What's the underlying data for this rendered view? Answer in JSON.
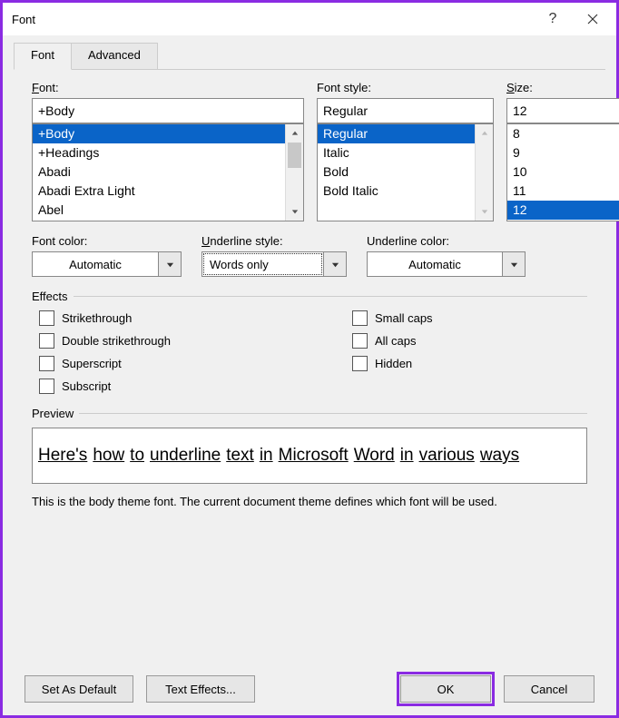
{
  "title": "Font",
  "tabs": {
    "font": "Font",
    "advanced": "Advanced"
  },
  "labels": {
    "font": "Font:",
    "style": "Font style:",
    "size": "Size:",
    "fontcolor": "Font color:",
    "underline": "Underline style:",
    "ulcolor": "Underline color:",
    "effects": "Effects",
    "preview": "Preview"
  },
  "font": {
    "value": "+Body",
    "items": [
      "+Body",
      "+Headings",
      "Abadi",
      "Abadi Extra Light",
      "Abel"
    ],
    "selected": 0
  },
  "style": {
    "value": "Regular",
    "items": [
      "Regular",
      "Italic",
      "Bold",
      "Bold Italic"
    ],
    "selected": 0
  },
  "size": {
    "value": "12",
    "items": [
      "8",
      "9",
      "10",
      "11",
      "12"
    ],
    "selected": 4
  },
  "fontcolor": "Automatic",
  "underline": "Words only",
  "ulcolor": "Automatic",
  "effects": {
    "strike": "Strikethrough",
    "dstrike": "Double strikethrough",
    "super": "Superscript",
    "sub": "Subscript",
    "smallcaps": "Small caps",
    "allcaps": "All caps",
    "hidden": "Hidden"
  },
  "preview_words": [
    "Here's",
    "how",
    "to",
    "underline",
    "text",
    "in",
    "Microsoft",
    "Word",
    "in",
    "various",
    "ways"
  ],
  "desc": "This is the body theme font. The current document theme defines which font will be used.",
  "buttons": {
    "default": "Set As Default",
    "texteffects": "Text Effects...",
    "ok": "OK",
    "cancel": "Cancel"
  }
}
